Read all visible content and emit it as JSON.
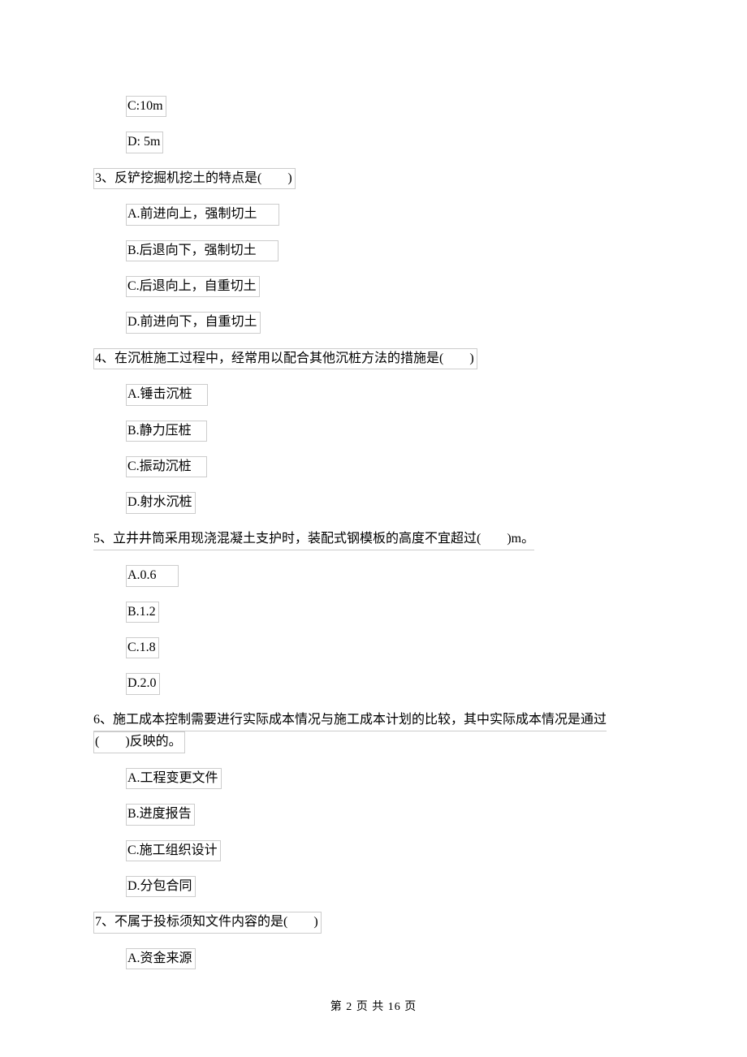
{
  "options_pre": {
    "c": "C:10m",
    "d": "D: 5m"
  },
  "q3": {
    "stem": "3、反铲挖掘机挖土的特点是(　　)",
    "a": "A.前进向上，强制切土",
    "b": "B.后退向下，强制切土",
    "c": "C.后退向上，自重切土",
    "d": "D.前进向下，自重切土"
  },
  "q4": {
    "stem": "4、在沉桩施工过程中，经常用以配合其他沉桩方法的措施是(　　)",
    "a": "A.锤击沉桩",
    "b": "B.静力压桩",
    "c": "C.振动沉桩",
    "d": "D.射水沉桩"
  },
  "q5": {
    "stem": "5、立井井筒采用现浇混凝土支护时，装配式钢模板的高度不宜超过(　　)m。",
    "a": "A.0.6",
    "b": "B.1.2",
    "c": "C.1.8",
    "d": "D.2.0"
  },
  "q6": {
    "stem_line1": "6、施工成本控制需要进行实际成本情况与施工成本计划的比较，其中实际成本情况是通过",
    "stem_line2": "(　　)反映的。",
    "a": "A.工程变更文件",
    "b": "B.进度报告",
    "c": "C.施工组织设计",
    "d": "D.分包合同"
  },
  "q7": {
    "stem": "7、不属于投标须知文件内容的是(　　)",
    "a": "A.资金来源"
  },
  "footer": "第 2 页 共 16 页"
}
